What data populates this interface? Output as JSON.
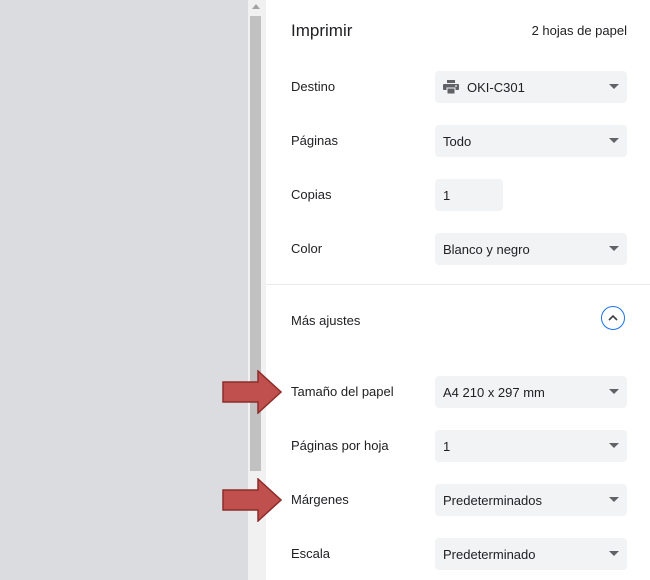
{
  "header": {
    "title": "Imprimir",
    "sheet_count": "2 hojas de papel"
  },
  "settings": {
    "destination": {
      "label": "Destino",
      "value": "OKI-C301",
      "icon": "printer-icon"
    },
    "pages": {
      "label": "Páginas",
      "value": "Todo"
    },
    "copies": {
      "label": "Copias",
      "value": "1"
    },
    "color": {
      "label": "Color",
      "value": "Blanco y negro"
    }
  },
  "more_settings": {
    "label": "Más ajustes",
    "toggle_icon": "chevron-up-icon",
    "accent_color": "#1a73e8"
  },
  "advanced": {
    "paper_size": {
      "label": "Tamaño del papel",
      "value": "A4 210 x 297 mm"
    },
    "pages_per_sheet": {
      "label": "Páginas por hoja",
      "value": "1"
    },
    "margins": {
      "label": "Márgenes",
      "value": "Predeterminados"
    },
    "scale": {
      "label": "Escala",
      "value": "Predeterminado"
    }
  },
  "annotations": {
    "arrow_color": "#c0504d",
    "arrow_targets": [
      "paper_size",
      "margins"
    ]
  }
}
